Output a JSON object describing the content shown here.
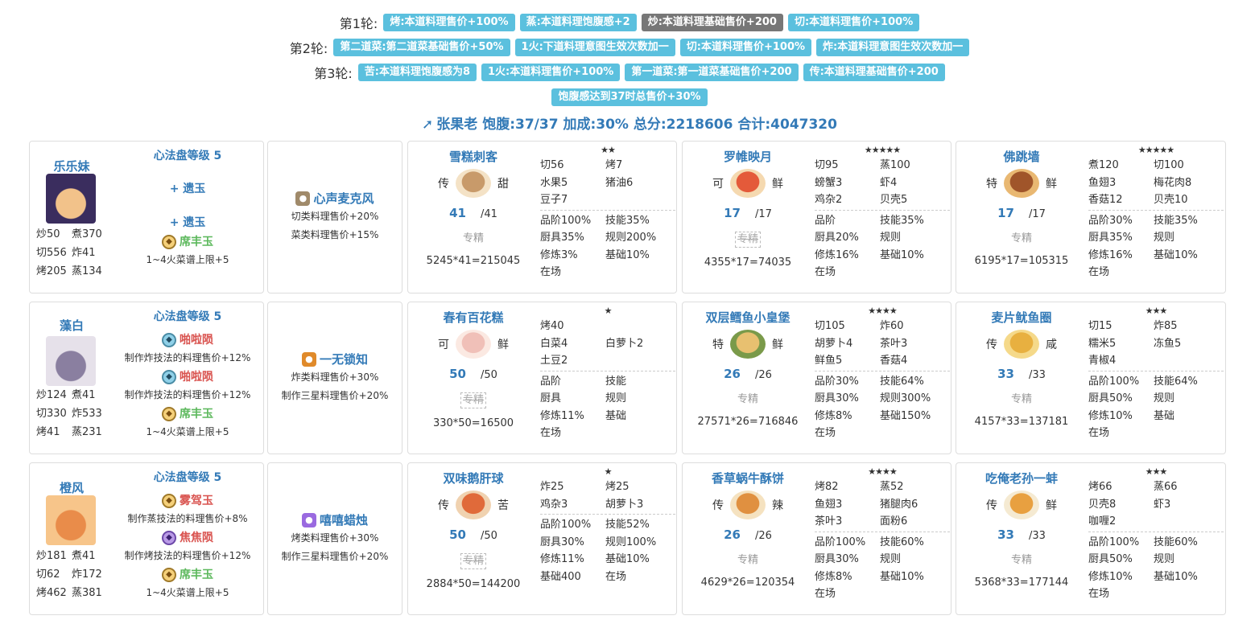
{
  "rules": [
    {
      "label": "第1轮:",
      "tags": [
        {
          "text": "烤:本道料理售价+100%",
          "style": "blue"
        },
        {
          "text": "蒸:本道料理饱腹感+2",
          "style": "blue"
        },
        {
          "text": "炒:本道料理基础售价+200",
          "style": "gray"
        },
        {
          "text": "切:本道料理售价+100%",
          "style": "blue"
        }
      ]
    },
    {
      "label": "第2轮:",
      "tags": [
        {
          "text": "第二道菜:第二道菜基础售价+50%",
          "style": "blue"
        },
        {
          "text": "1火:下道料理意图生效次数加一",
          "style": "blue"
        },
        {
          "text": "切:本道料理售价+100%",
          "style": "blue"
        },
        {
          "text": "炸:本道料理意图生效次数加一",
          "style": "blue"
        }
      ]
    },
    {
      "label": "第3轮:",
      "tags": [
        {
          "text": "苦:本道料理饱腹感为8",
          "style": "blue"
        },
        {
          "text": "1火:本道料理售价+100%",
          "style": "blue"
        },
        {
          "text": "第一道菜:第一道菜基础售价+200",
          "style": "blue"
        },
        {
          "text": "传:本道料理基础售价+200",
          "style": "blue"
        }
      ]
    },
    {
      "label": "",
      "tags": [
        {
          "text": "饱腹感达到37时总售价+30%",
          "style": "blue"
        }
      ]
    }
  ],
  "summary": {
    "icon": "sword-icon",
    "text": "张果老 饱腹:37/37 加成:30% 总分:2218606 合计:4047320"
  },
  "rows": [
    {
      "chef": {
        "name": "乐乐妹",
        "stats": [
          "炒50",
          "煮370",
          "切556",
          "炸41",
          "烤205",
          "蒸134"
        ]
      },
      "heart": {
        "title": "心法盘等级 5",
        "jades": [
          {
            "name": "+ 遗玉",
            "color": "blue",
            "desc": ""
          },
          {
            "name": "+ 遗玉",
            "color": "blue",
            "desc": ""
          },
          {
            "name": "席丰玉",
            "color": "green",
            "desc": "1~4火菜谱上限+5",
            "icon": "gold-jade-icon"
          }
        ]
      },
      "equip": {
        "name": "心声麦克风",
        "icon": "microphone-icon",
        "descs": [
          "切类料理售价+20%",
          "菜类料理售价+15%"
        ]
      },
      "recipes": [
        {
          "name": "雪糕刺客",
          "rarity": "传",
          "flavor": "甜",
          "qty": "41",
          "max": "/41",
          "specialty": "专精",
          "spec_strike": false,
          "calc": "5245*41=215045",
          "stars": "★★",
          "ing": [
            "切56",
            "烤7",
            "水果5",
            "猪油6",
            "豆子7",
            ""
          ],
          "bonus": [
            "品阶100%",
            "技能35%",
            "厨具35%",
            "规则200%",
            "修炼3%",
            "基础10%",
            "在场",
            ""
          ]
        },
        {
          "name": "罗帷映月",
          "rarity": "可",
          "flavor": "鲜",
          "qty": "17",
          "max": "/17",
          "specialty": "专精",
          "spec_strike": true,
          "calc": "4355*17=74035",
          "stars": "★★★★★",
          "ing": [
            "切95",
            "蒸100",
            "螃蟹3",
            "虾4",
            "鸡杂2",
            "贝壳5"
          ],
          "bonus": [
            "品阶",
            "技能35%",
            "厨具20%",
            "规则",
            "修炼16%",
            "基础10%",
            "在场",
            ""
          ]
        },
        {
          "name": "佛跳墙",
          "rarity": "特",
          "flavor": "鲜",
          "qty": "17",
          "max": "/17",
          "specialty": "专精",
          "spec_strike": false,
          "calc": "6195*17=105315",
          "stars": "★★★★★",
          "ing": [
            "煮120",
            "切100",
            "鱼翅3",
            "梅花肉8",
            "香菇12",
            "贝壳10"
          ],
          "bonus": [
            "品阶30%",
            "技能35%",
            "厨具35%",
            "规则",
            "修炼16%",
            "基础10%",
            "在场",
            ""
          ]
        }
      ]
    },
    {
      "chef": {
        "name": "藻白",
        "stats": [
          "炒124",
          "煮41",
          "切330",
          "炸533",
          "烤41",
          "蒸231"
        ]
      },
      "heart": {
        "title": "心法盘等级 5",
        "jades": [
          {
            "name": "啪啦陨",
            "color": "red",
            "desc": "制作炸技法的料理售价+12%",
            "icon": "blue-jade-icon"
          },
          {
            "name": "啪啦陨",
            "color": "red",
            "desc": "制作炸技法的料理售价+12%",
            "icon": "blue-jade-icon"
          },
          {
            "name": "席丰玉",
            "color": "green",
            "desc": "1~4火菜谱上限+5",
            "icon": "gold-jade-icon"
          }
        ]
      },
      "equip": {
        "name": "一无锁知",
        "icon": "lock-icon",
        "descs": [
          "炸类料理售价+30%",
          "制作三星料理售价+20%"
        ]
      },
      "recipes": [
        {
          "name": "春有百花糕",
          "rarity": "可",
          "flavor": "鲜",
          "qty": "50",
          "max": "/50",
          "specialty": "专精",
          "spec_strike": true,
          "calc": "330*50=16500",
          "stars": "★",
          "ing": [
            "烤40",
            "",
            "白菜4",
            "白萝卜2",
            "土豆2",
            ""
          ],
          "bonus": [
            "品阶",
            "技能",
            "厨具",
            "规则",
            "修炼11%",
            "基础",
            "在场",
            ""
          ]
        },
        {
          "name": "双层鳕鱼小皇堡",
          "rarity": "特",
          "flavor": "鲜",
          "qty": "26",
          "max": "/26",
          "specialty": "专精",
          "spec_strike": false,
          "calc": "27571*26=716846",
          "stars": "★★★★",
          "ing": [
            "切105",
            "炸60",
            "胡萝卜4",
            "茶叶3",
            "鲜鱼5",
            "香菇4"
          ],
          "bonus": [
            "品阶30%",
            "技能64%",
            "厨具30%",
            "规则300%",
            "修炼8%",
            "基础150%",
            "在场",
            ""
          ]
        },
        {
          "name": "麦片鱿鱼圈",
          "rarity": "传",
          "flavor": "咸",
          "qty": "33",
          "max": "/33",
          "specialty": "专精",
          "spec_strike": false,
          "calc": "4157*33=137181",
          "stars": "★★★",
          "ing": [
            "切15",
            "炸85",
            "糯米5",
            "冻鱼5",
            "青椒4",
            ""
          ],
          "bonus": [
            "品阶100%",
            "技能64%",
            "厨具50%",
            "规则",
            "修炼10%",
            "基础",
            "在场",
            ""
          ]
        }
      ]
    },
    {
      "chef": {
        "name": "橙风",
        "stats": [
          "炒181",
          "煮41",
          "切62",
          "炸172",
          "烤462",
          "蒸381"
        ]
      },
      "heart": {
        "title": "心法盘等级 5",
        "jades": [
          {
            "name": "雾驾玉",
            "color": "red",
            "desc": "制作蒸技法的料理售价+8%",
            "icon": "gold-jade-icon"
          },
          {
            "name": "焦焦陨",
            "color": "red",
            "desc": "制作烤技法的料理售价+12%",
            "icon": "purple-jade-icon"
          },
          {
            "name": "席丰玉",
            "color": "green",
            "desc": "1~4火菜谱上限+5",
            "icon": "gold-jade-icon"
          }
        ]
      },
      "equip": {
        "name": "嘻嘻蜡烛",
        "icon": "candle-icon",
        "descs": [
          "烤类料理售价+30%",
          "制作三星料理售价+20%"
        ]
      },
      "recipes": [
        {
          "name": "双味鹅肝球",
          "rarity": "传",
          "flavor": "苦",
          "qty": "50",
          "max": "/50",
          "specialty": "专精",
          "spec_strike": true,
          "calc": "2884*50=144200",
          "stars": "★",
          "ing": [
            "炸25",
            "烤25",
            "鸡杂3",
            "胡萝卜3",
            "",
            ""
          ],
          "bonus": [
            "品阶100%",
            "技能52%",
            "厨具30%",
            "规则100%",
            "修炼11%",
            "基础10%",
            "基础400",
            "在场"
          ]
        },
        {
          "name": "香草蜗牛酥饼",
          "rarity": "传",
          "flavor": "辣",
          "qty": "26",
          "max": "/26",
          "specialty": "专精",
          "spec_strike": false,
          "calc": "4629*26=120354",
          "stars": "★★★★",
          "ing": [
            "烤82",
            "蒸52",
            "鱼翅3",
            "猪腿肉6",
            "茶叶3",
            "面粉6"
          ],
          "bonus": [
            "品阶100%",
            "技能60%",
            "厨具30%",
            "规则",
            "修炼8%",
            "基础10%",
            "在场",
            ""
          ]
        },
        {
          "name": "吃俺老孙一蚌",
          "rarity": "传",
          "flavor": "鲜",
          "qty": "33",
          "max": "/33",
          "specialty": "专精",
          "spec_strike": false,
          "calc": "5368*33=177144",
          "stars": "★★★",
          "ing": [
            "烤66",
            "蒸66",
            "贝壳8",
            "虾3",
            "咖喱2",
            ""
          ],
          "bonus": [
            "品阶100%",
            "技能60%",
            "厨具50%",
            "规则",
            "修炼10%",
            "基础10%",
            "在场",
            ""
          ]
        }
      ]
    }
  ]
}
